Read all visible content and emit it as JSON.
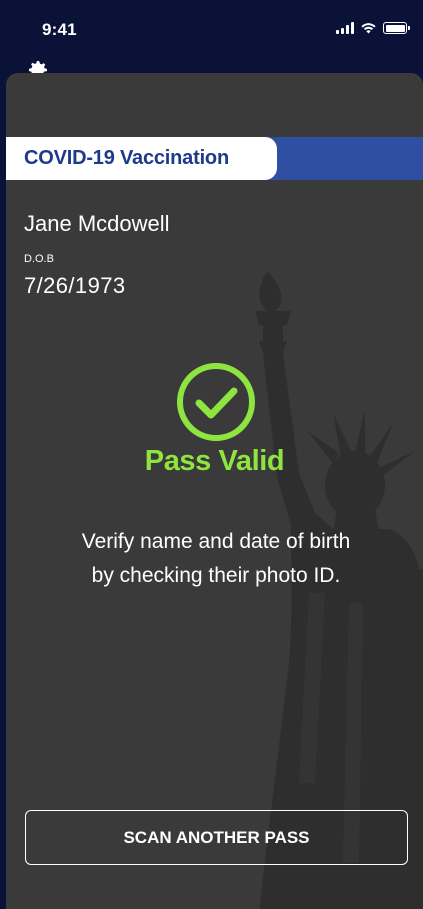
{
  "status_bar": {
    "time": "9:41",
    "icons": [
      "cellular-signal-icon",
      "wifi-icon",
      "battery-icon"
    ]
  },
  "header": {
    "peek_icon": "gear-icon"
  },
  "pass": {
    "banner_title": "COVID-19 Vaccination",
    "holder_name": "Jane Mcdowell",
    "dob_label": "D.O.B",
    "dob_value": "7/26/1973",
    "status_icon": "check-circle-icon",
    "status_text": "Pass Valid",
    "instructions_line1": "Verify name and date of birth",
    "instructions_line2": "by checking their photo ID.",
    "background_image": "statue-of-liberty-silhouette"
  },
  "actions": {
    "scan_another_label": "SCAN ANOTHER PASS"
  },
  "colors": {
    "top_background": "#0b1238",
    "card_background": "#3a3a3a",
    "banner_blue": "#2f4fa3",
    "banner_text": "#1f3a8a",
    "valid_green": "#8ee53f",
    "text_white": "#ffffff"
  }
}
